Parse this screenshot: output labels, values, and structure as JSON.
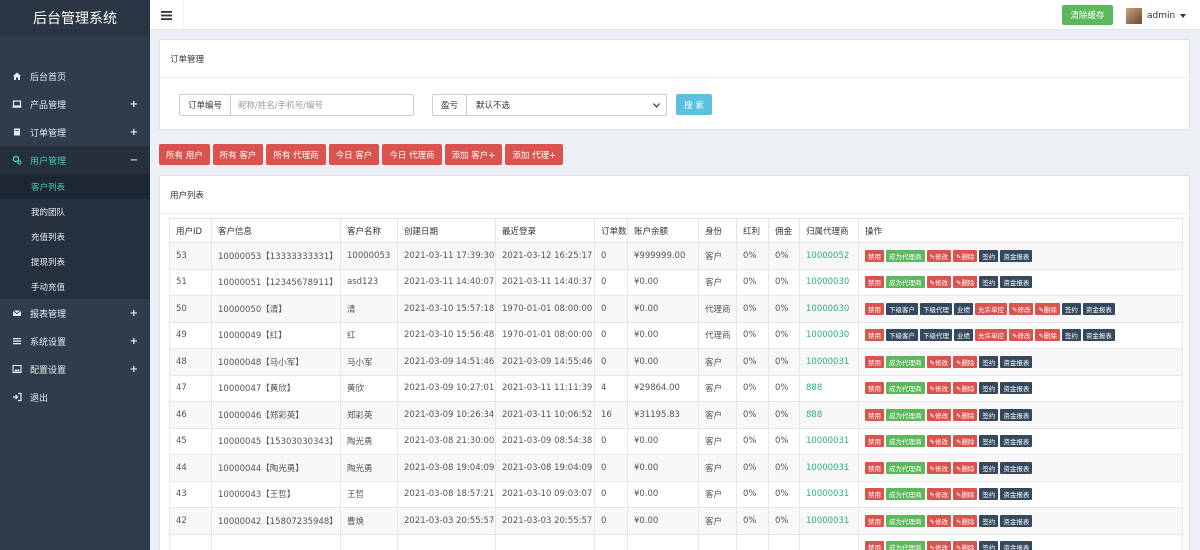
{
  "app": {
    "title": "后台管理系统"
  },
  "sidebar": {
    "items": [
      {
        "label": "后台首页",
        "icon": "home-icon",
        "toggle": ""
      },
      {
        "label": "产品管理",
        "icon": "laptop-icon",
        "toggle": "+"
      },
      {
        "label": "订单管理",
        "icon": "book-icon",
        "toggle": "+"
      },
      {
        "label": "用户管理",
        "icon": "cogs-icon",
        "toggle": "−",
        "active": true
      },
      {
        "label": "报表管理",
        "icon": "envelope-icon",
        "toggle": "+"
      },
      {
        "label": "系统设置",
        "icon": "list-icon",
        "toggle": "+"
      },
      {
        "label": "配置设置",
        "icon": "picture-icon",
        "toggle": "+"
      },
      {
        "label": "退出",
        "icon": "sign-out-icon",
        "toggle": ""
      }
    ],
    "subitems": [
      "客户列表",
      "我的团队",
      "充值列表",
      "提现列表",
      "手动充值"
    ]
  },
  "topbar": {
    "clear_label": "清除缓存",
    "username": "admin"
  },
  "order_panel": {
    "title": "订单管理",
    "order_no_label": "订单编号",
    "order_no_placeholder": "昵称/姓名/手机号/编号",
    "profit_label": "盈亏",
    "profit_value": "默认不选",
    "search_label": "搜 索"
  },
  "filters": [
    "所有 用户",
    "所有 客户",
    "所有 代理商",
    "今日 客户",
    "今日 代理商",
    "添加 客户+",
    "添加 代理+"
  ],
  "list_panel": {
    "title": "用户列表"
  },
  "table": {
    "headers": [
      "用户ID",
      "客户信息",
      "客户名称",
      "创建日期",
      "最近登录",
      "订单数",
      "账户余额",
      "身份",
      "红利",
      "佣金",
      "归属代理商",
      "操作"
    ],
    "rows": [
      {
        "id": "53",
        "info": "10000053【13333333331】",
        "name": "10000053",
        "created": "2021-03-11 17:39:30",
        "last": "2021-03-12 16:25:17",
        "orders": "0",
        "balance": "¥999999.00",
        "role": "客户",
        "bonus": "0%",
        "comm": "0%",
        "agent": "10000052",
        "type": "customer"
      },
      {
        "id": "51",
        "info": "10000051【12345678911】",
        "name": "asd123",
        "created": "2021-03-11 14:40:07",
        "last": "2021-03-11 14:40:37",
        "orders": "0",
        "balance": "¥0.00",
        "role": "客户",
        "bonus": "0%",
        "comm": "0%",
        "agent": "10000030",
        "type": "customer"
      },
      {
        "id": "50",
        "info": "10000050【清】",
        "name": "清",
        "created": "2021-03-10 15:57:18",
        "last": "1970-01-01 08:00:00",
        "orders": "0",
        "balance": "¥0.00",
        "role": "代理商",
        "bonus": "0%",
        "comm": "0%",
        "agent": "10000030",
        "type": "agent"
      },
      {
        "id": "49",
        "info": "10000049【红】",
        "name": "红",
        "created": "2021-03-10 15:56:48",
        "last": "1970-01-01 08:00:00",
        "orders": "0",
        "balance": "¥0.00",
        "role": "代理商",
        "bonus": "0%",
        "comm": "0%",
        "agent": "10000030",
        "type": "agent"
      },
      {
        "id": "48",
        "info": "10000048【马小军】",
        "name": "马小军",
        "created": "2021-03-09 14:51:46",
        "last": "2021-03-09 14:55:46",
        "orders": "0",
        "balance": "¥0.00",
        "role": "客户",
        "bonus": "0%",
        "comm": "0%",
        "agent": "10000031",
        "type": "customer"
      },
      {
        "id": "47",
        "info": "10000047【黄欣】",
        "name": "黄欣",
        "created": "2021-03-09 10:27:01",
        "last": "2021-03-11 11:11:39",
        "orders": "4",
        "balance": "¥29864.00",
        "role": "客户",
        "bonus": "0%",
        "comm": "0%",
        "agent": "888",
        "type": "customer"
      },
      {
        "id": "46",
        "info": "10000046【郑彩英】",
        "name": "郑彩英",
        "created": "2021-03-09 10:26:34",
        "last": "2021-03-11 10:06:52",
        "orders": "16",
        "balance": "¥31195.83",
        "role": "客户",
        "bonus": "0%",
        "comm": "0%",
        "agent": "888",
        "type": "customer"
      },
      {
        "id": "45",
        "info": "10000045【15303030343】",
        "name": "陶光勇",
        "created": "2021-03-08 21:30:00",
        "last": "2021-03-09 08:54:38",
        "orders": "0",
        "balance": "¥0.00",
        "role": "客户",
        "bonus": "0%",
        "comm": "0%",
        "agent": "10000031",
        "type": "customer"
      },
      {
        "id": "44",
        "info": "10000044【陶光勇】",
        "name": "陶光勇",
        "created": "2021-03-08 19:04:09",
        "last": "2021-03-08 19:04:09",
        "orders": "0",
        "balance": "¥0.00",
        "role": "客户",
        "bonus": "0%",
        "comm": "0%",
        "agent": "10000031",
        "type": "customer"
      },
      {
        "id": "43",
        "info": "10000043【王哲】",
        "name": "王哲",
        "created": "2021-03-08 18:57:21",
        "last": "2021-03-10 09:03:07",
        "orders": "0",
        "balance": "¥0.00",
        "role": "客户",
        "bonus": "0%",
        "comm": "0%",
        "agent": "10000031",
        "type": "customer"
      },
      {
        "id": "42",
        "info": "10000042【15807235948】",
        "name": "曹焕",
        "created": "2021-03-03 20:55:57",
        "last": "2021-03-03 20:55:57",
        "orders": "0",
        "balance": "¥0.00",
        "role": "客户",
        "bonus": "0%",
        "comm": "0%",
        "agent": "10000031",
        "type": "customer"
      },
      {
        "id": "",
        "info": "",
        "name": "",
        "created": "",
        "last": "",
        "orders": "",
        "balance": "",
        "role": "",
        "bonus": "",
        "comm": "",
        "agent": "",
        "type": "customer"
      }
    ],
    "customer_actions": [
      {
        "label": "禁用",
        "color": "red"
      },
      {
        "label": "成为代理商",
        "color": "green"
      },
      {
        "label": "✎修改",
        "color": "red"
      },
      {
        "label": "✎删除",
        "color": "red"
      },
      {
        "label": "签约",
        "color": "dark"
      },
      {
        "label": "资金报表",
        "color": "dark"
      }
    ],
    "agent_actions": [
      {
        "label": "禁用",
        "color": "red"
      },
      {
        "label": "下级客户",
        "color": "dark"
      },
      {
        "label": "下级代理",
        "color": "dark"
      },
      {
        "label": "业绩",
        "color": "dark"
      },
      {
        "label": "允许单控",
        "color": "red"
      },
      {
        "label": "✎修改",
        "color": "red"
      },
      {
        "label": "✎删除",
        "color": "red"
      },
      {
        "label": "签约",
        "color": "dark"
      },
      {
        "label": "资金报表",
        "color": "dark"
      }
    ]
  }
}
